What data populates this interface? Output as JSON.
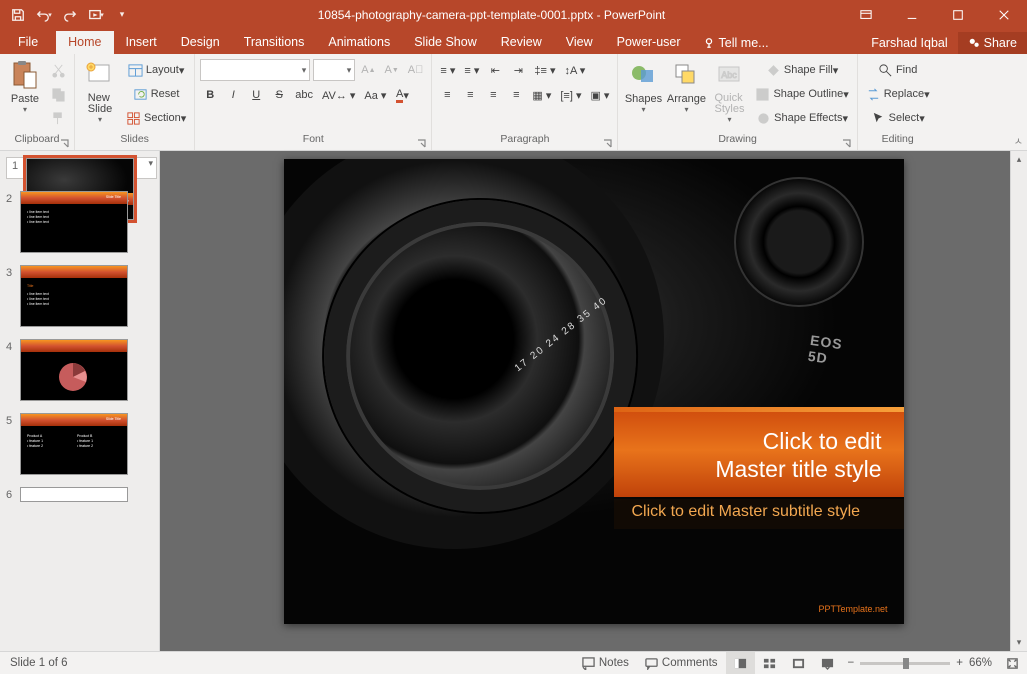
{
  "titlebar": {
    "title": "10854-photography-camera-ppt-template-0001.pptx - PowerPoint"
  },
  "menu": {
    "file": "File",
    "home": "Home",
    "insert": "Insert",
    "design": "Design",
    "transitions": "Transitions",
    "animations": "Animations",
    "slideshow": "Slide Show",
    "review": "Review",
    "view": "View",
    "poweruser": "Power-user",
    "tellme": "Tell me...",
    "user": "Farshad Iqbal",
    "share": "Share"
  },
  "ribbon": {
    "clipboard": {
      "label": "Clipboard",
      "paste": "Paste"
    },
    "slides": {
      "label": "Slides",
      "newslide": "New\nSlide",
      "layout": "Layout",
      "reset": "Reset",
      "section": "Section"
    },
    "font": {
      "label": "Font"
    },
    "paragraph": {
      "label": "Paragraph"
    },
    "drawing": {
      "label": "Drawing",
      "shapes": "Shapes",
      "arrange": "Arrange",
      "quick": "Quick\nStyles",
      "fill": "Shape Fill",
      "outline": "Shape Outline",
      "effects": "Shape Effects"
    },
    "editing": {
      "label": "Editing",
      "find": "Find",
      "replace": "Replace",
      "select": "Select"
    }
  },
  "thumbs": {
    "count": 6
  },
  "slide": {
    "title_l1": "Click to edit",
    "title_l2": "Master title style",
    "subtitle": "Click to edit Master subtitle style",
    "lensnum": "17 20 24 28   35 40",
    "eos": "EOS\n5D",
    "watermark": "PPTTemplate.net"
  },
  "status": {
    "slideinfo": "Slide 1 of 6",
    "notes": "Notes",
    "comments": "Comments",
    "zoom_pct": "66%"
  }
}
